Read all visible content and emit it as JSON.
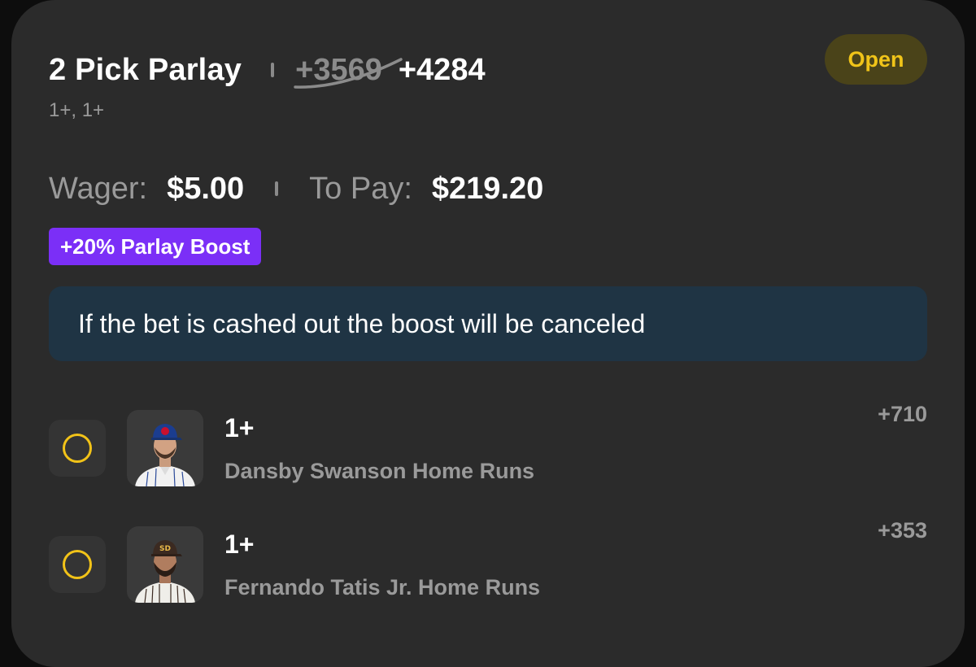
{
  "bet": {
    "title": "2 Pick Parlay",
    "original_odds": "+3569",
    "boosted_odds": "+4284",
    "subtitle": "1+, 1+",
    "status": "Open",
    "wager_label": "Wager:",
    "wager_value": "$5.00",
    "to_pay_label": "To Pay:",
    "to_pay_value": "$219.20",
    "boost_badge": "+20% Parlay Boost",
    "notice": "If the bet is cashed out the boost will be canceled"
  },
  "legs": [
    {
      "line": "1+",
      "name": "Dansby Swanson Home Runs",
      "odds": "+710",
      "avatar_icon": "player-headshot-cubs",
      "cap_color": "#1b3d8f",
      "cap_logo_color": "#c8102e",
      "jersey_color": "#f1f1f1",
      "pinstripe_color": "#2b4a9a"
    },
    {
      "line": "1+",
      "name": "Fernando Tatis Jr. Home Runs",
      "odds": "+353",
      "avatar_icon": "player-headshot-padres",
      "cap_color": "#3b2a21",
      "cap_logo_color": "#e9b949",
      "jersey_color": "#efeee9",
      "pinstripe_color": "#3b2a21"
    }
  ],
  "colors": {
    "accent_yellow": "#f2c318",
    "boost_purple": "#7b2ff7",
    "notice_bg": "#1f3444",
    "card_bg": "#2b2b2b"
  }
}
